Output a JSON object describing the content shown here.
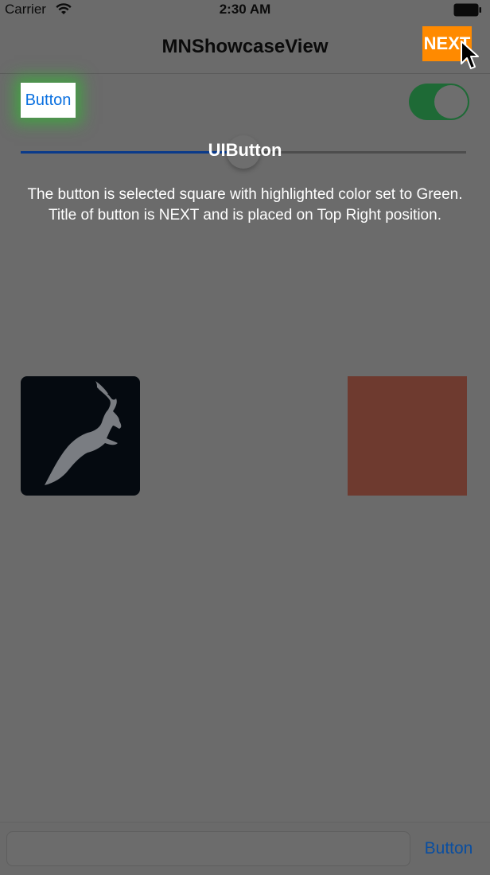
{
  "status_bar": {
    "carrier": "Carrier",
    "time": "2:30 AM",
    "icons": [
      "wifi-icon",
      "battery-icon"
    ]
  },
  "nav": {
    "title": "MNShowcaseView",
    "next_label": "NEXT",
    "next_color": "#ff8a00"
  },
  "showcase": {
    "button_label": "Button",
    "highlight_color": "#2ec82e",
    "title": "UIButton",
    "description": "The button is selected square with highlighted color set to Green. Title of button is NEXT and is placed on Top Right position."
  },
  "controls": {
    "toggle_on": true,
    "slider_value": 0.5
  },
  "images": {
    "logo_icon": "leaping-goat-icon",
    "color_box": "#6e3a2f"
  },
  "bottom_bar": {
    "text_field_value": "",
    "text_field_placeholder": "",
    "button_label": "Button"
  }
}
